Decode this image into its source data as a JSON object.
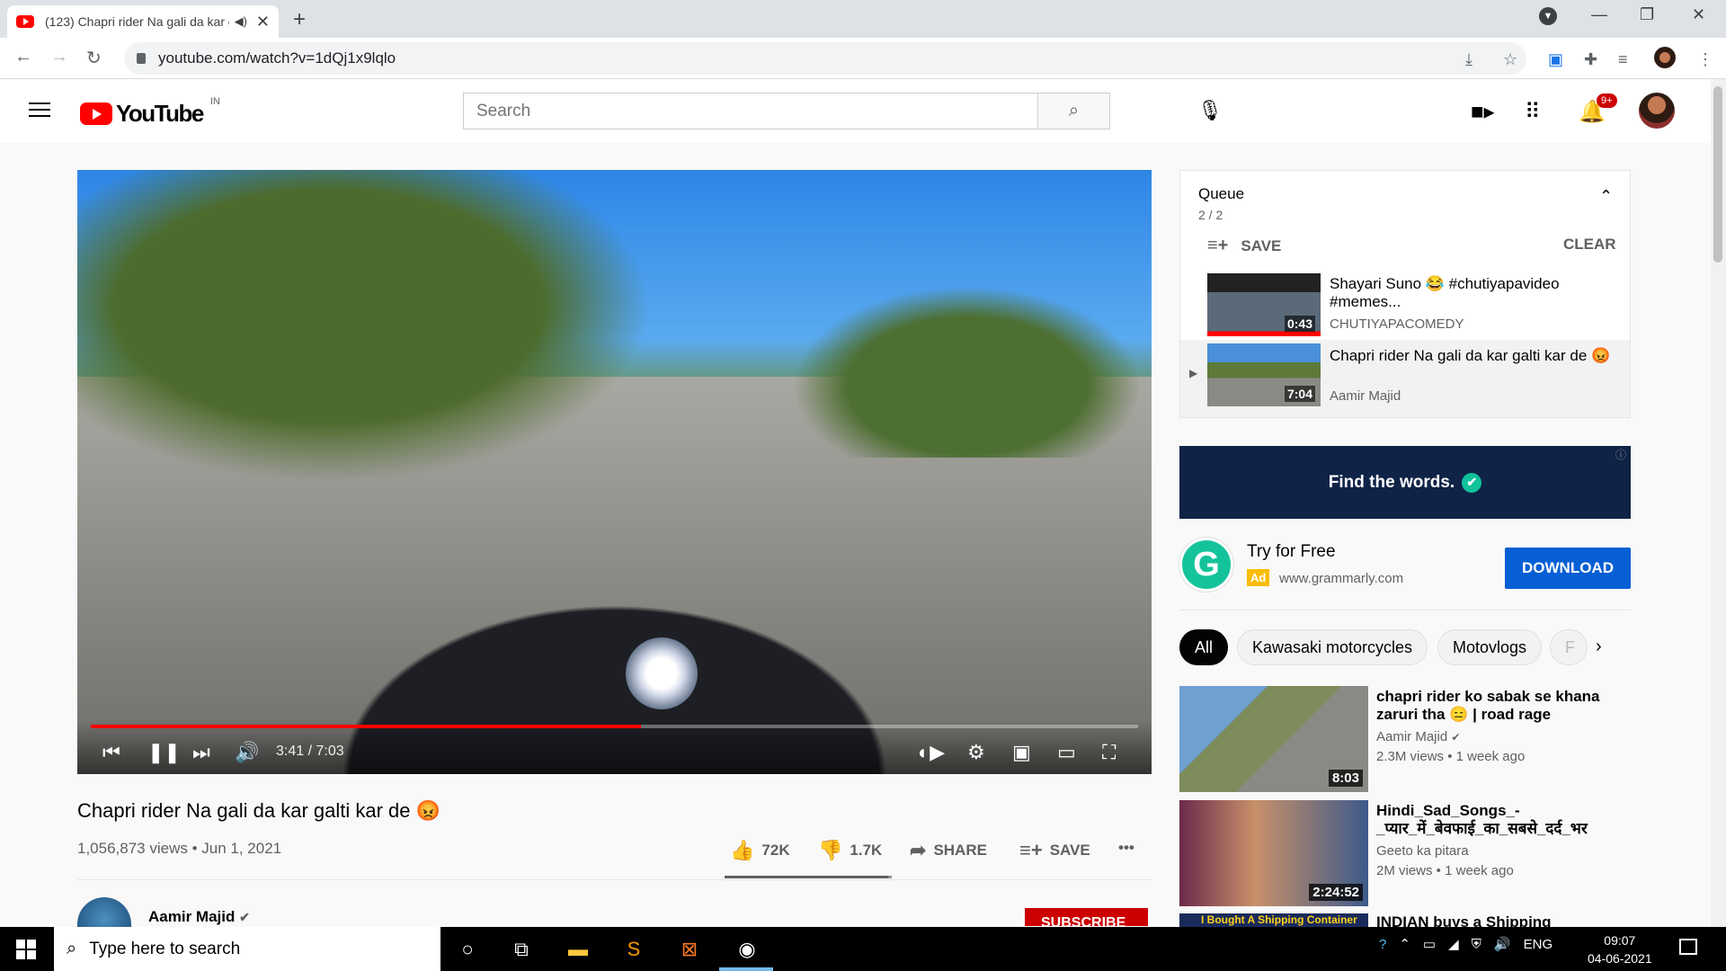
{
  "browser": {
    "tab_title": "(123) Chapri rider Na gali da kar galti kar de",
    "url": "youtube.com/watch?v=1dQj1x9lqlo",
    "icons": [
      "back-icon",
      "forward-icon",
      "reload-icon",
      "lock-icon",
      "install-icon",
      "star-icon",
      "extension-icon",
      "puzzle-icon",
      "media-icon",
      "profile-icon",
      "menu-icon"
    ]
  },
  "yt_header": {
    "logo_text": "YouTube",
    "country_code": "IN",
    "search_placeholder": "Search",
    "notif_badge": "9+"
  },
  "player": {
    "time": "3:41 / 7:03",
    "progress": 0.525
  },
  "video": {
    "title": "Chapri rider Na gali da kar galti kar de 😡",
    "meta": "1,056,873 views • Jun 1, 2021",
    "likes": "72K",
    "dislikes": "1.7K",
    "share_label": "SHARE",
    "save_label": "SAVE",
    "like_ratio": 0.977,
    "channel": "Aamir Majid",
    "subscribe_label": "SUBSCRIBE"
  },
  "queue": {
    "title": "Queue",
    "count": "2 / 2",
    "save_label": "SAVE",
    "clear_label": "CLEAR",
    "items": [
      {
        "title": "Shayari Suno 😂 #chutiyapavideo #memes...",
        "channel": "CHUTIYAPACOMEDY",
        "duration": "0:43"
      },
      {
        "title": "Chapri rider Na gali da kar galti kar de 😡",
        "channel": "Aamir Majid",
        "duration": "7:04"
      }
    ]
  },
  "ad": {
    "banner_text": "Find the words.",
    "title": "Try for Free",
    "badge": "Ad",
    "url": "www.grammarly.com",
    "button": "DOWNLOAD",
    "logo_letter": "G"
  },
  "chips": [
    "All",
    "Kawasaki motorcycles",
    "Motovlogs",
    "F"
  ],
  "recommendations": [
    {
      "title": "chapri rider ko sabak se khana zaruri tha 😑 | road rage",
      "channel": "Aamir Majid",
      "meta": "2.3M views • 1 week ago",
      "duration": "8:03"
    },
    {
      "title": "Hindi_Sad_Songs_-_प्यार_में_बेवफाई_का_सबसे_दर्द_भर",
      "channel": "Geeto ka pitara",
      "meta": "2M views • 1 week ago",
      "duration": "2:24:52"
    },
    {
      "title": "INDIAN buys a Shipping",
      "thumb_text": "I Bought A Shipping Container"
    }
  ],
  "taskbar": {
    "search_placeholder": "Type here to search",
    "lang": "ENG",
    "time": "09:07",
    "date": "04-06-2021"
  },
  "colors": {
    "yt_red": "#ff0000",
    "download_blue": "#065fd4",
    "grammarly_green": "#15c39a",
    "subscribe_red": "#cc0000"
  }
}
